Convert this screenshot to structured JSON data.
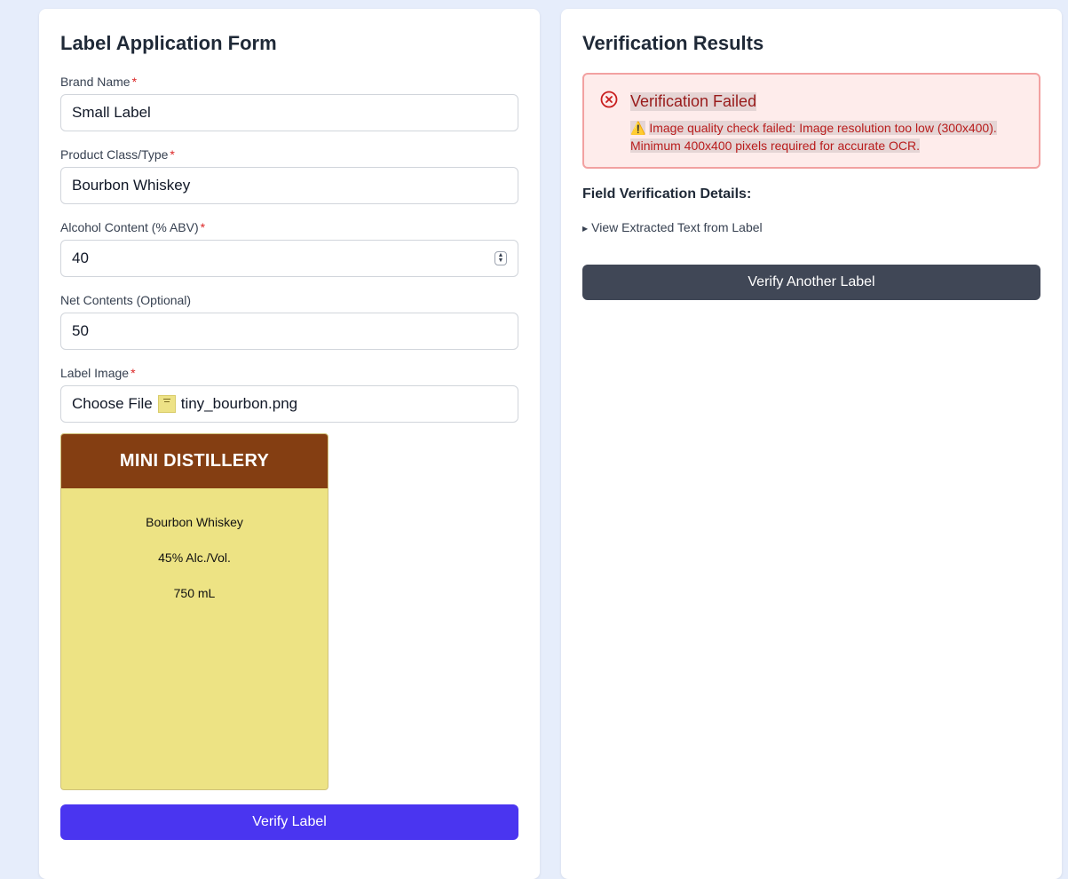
{
  "form": {
    "title": "Label Application Form",
    "brand_name": {
      "label": "Brand Name",
      "required": "*",
      "value": "Small Label"
    },
    "product_class": {
      "label": "Product Class/Type",
      "required": "*",
      "value": "Bourbon Whiskey"
    },
    "alcohol_content": {
      "label": "Alcohol Content (% ABV)",
      "required": "*",
      "value": "40"
    },
    "net_contents": {
      "label": "Net Contents (Optional)",
      "value": "50"
    },
    "label_image": {
      "label": "Label Image",
      "required": "*",
      "button": "Choose File",
      "filename": "tiny_bourbon.png"
    },
    "preview": {
      "header": "MINI DISTILLERY",
      "line1": "Bourbon Whiskey",
      "line2": "45% Alc./Vol.",
      "line3": "750 mL"
    },
    "submit_label": "Verify Label"
  },
  "results": {
    "title": "Verification Results",
    "alert": {
      "title": "Verification Failed",
      "message_icon": "⚠️",
      "message": "Image quality check failed: Image resolution too low (300x400). Minimum 400x400 pixels required for accurate OCR."
    },
    "details_heading": "Field Verification Details:",
    "extracted_toggle": "View Extracted Text from Label",
    "reset_label": "Verify Another Label"
  },
  "colors": {
    "primary": "#4a35f0",
    "secondary": "#404756",
    "error": "#b91c1c",
    "label_header": "#843e12",
    "label_body": "#ede384"
  }
}
